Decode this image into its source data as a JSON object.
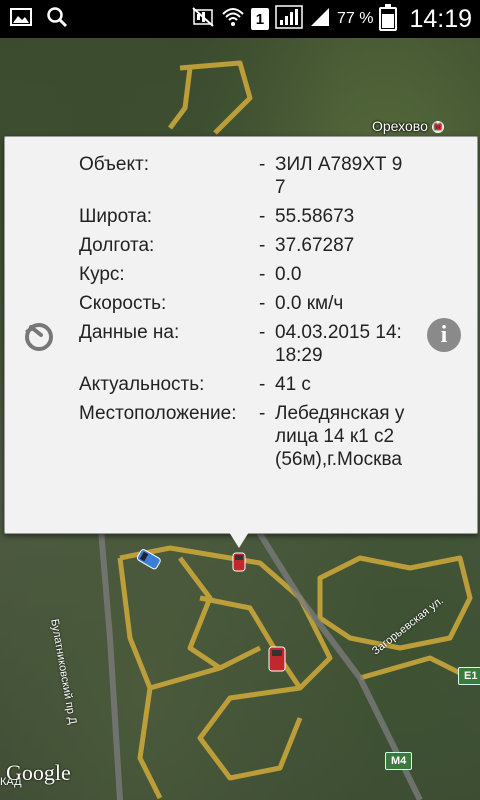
{
  "status_bar": {
    "battery": "77 %",
    "battery_level": 0.77,
    "time": "14:19",
    "sim_number": "1",
    "icons": [
      "image-icon",
      "search-icon",
      "mute-icon",
      "wifi-icon",
      "sim-icon",
      "signal-icon",
      "battery-icon"
    ]
  },
  "map": {
    "labels": {
      "orekhovo": "Орехово",
      "bulatnikovsky": "Булатниковский пр Д",
      "zagoryevskaya": "Загорьевская ул.",
      "m4": "М4",
      "e": "E1",
      "kad": "КАД"
    },
    "google": "Google"
  },
  "popup": {
    "rows": [
      {
        "key": "Объект:",
        "dash": "-",
        "value": "ЗИЛ А789ХТ 97"
      },
      {
        "key": "Широта:",
        "dash": "-",
        "value": "55.58673"
      },
      {
        "key": "Долгота:",
        "dash": "-",
        "value": "37.67287"
      },
      {
        "key": "Курс:",
        "dash": "-",
        "value": "0.0"
      },
      {
        "key": "Скорость:",
        "dash": "-",
        "value": "0.0 км/ч"
      },
      {
        "key": "Данные на:",
        "dash": "-",
        "value": "04.03.2015 14:18:29"
      },
      {
        "key": "Актуальность:",
        "dash": "-",
        "value": "41 с"
      },
      {
        "key": "Местоположение:",
        "dash": "-",
        "value": "Лебедянская улица 14 к1 с2 (56м),г.Москва"
      }
    ],
    "info_symbol": "i"
  }
}
